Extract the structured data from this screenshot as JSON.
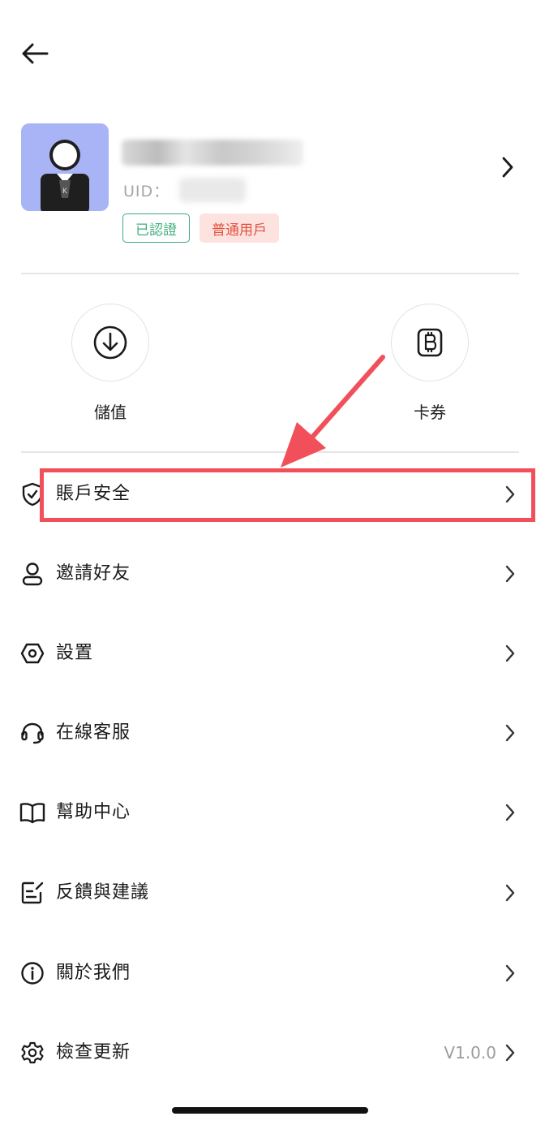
{
  "header": {
    "back_icon": "arrow-left-icon"
  },
  "profile": {
    "uid_label": "UID：",
    "badges": [
      "已認證",
      "普通用戶"
    ],
    "avatar_icon": "user-avatar-icon",
    "avatar_initial": "K",
    "chevron_icon": "chevron-right-icon"
  },
  "quick_actions": [
    {
      "label": "儲值",
      "icon": "download-circle-icon"
    },
    {
      "label": "卡券",
      "icon": "bitcoin-coupon-icon"
    }
  ],
  "menu": [
    {
      "label": "賬戶安全",
      "icon": "shield-check-icon"
    },
    {
      "label": "邀請好友",
      "icon": "person-icon"
    },
    {
      "label": "設置",
      "icon": "hexagon-settings-icon"
    },
    {
      "label": "在線客服",
      "icon": "headset-icon"
    },
    {
      "label": "幫助中心",
      "icon": "book-icon"
    },
    {
      "label": "反饋與建議",
      "icon": "feedback-edit-icon"
    },
    {
      "label": "關於我們",
      "icon": "info-icon"
    },
    {
      "label": "檢查更新",
      "icon": "gear-icon",
      "value": "V1.0.0"
    }
  ],
  "colors": {
    "verified_green": "#3fae7e",
    "user_badge_red": "#e4513f",
    "user_badge_bg": "#fde3df",
    "avatar_bg": "#a9b4f6",
    "annotation_red": "#f1505a",
    "version_gray": "#9c9c9c"
  }
}
